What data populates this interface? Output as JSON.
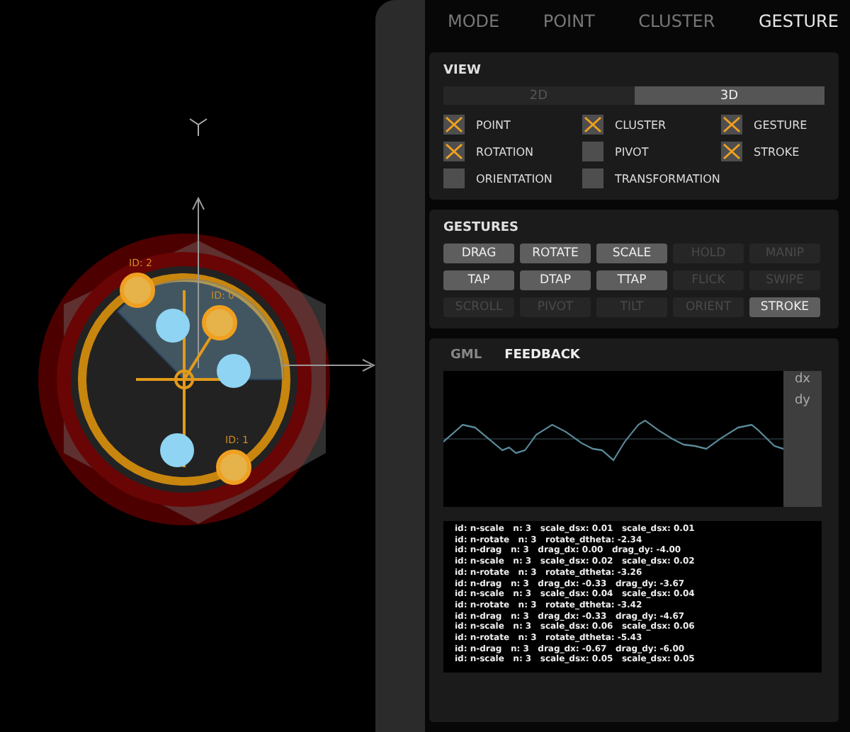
{
  "tabs": [
    {
      "label": "MODE",
      "selected": false
    },
    {
      "label": "POINT",
      "selected": false
    },
    {
      "label": "CLUSTER",
      "selected": false
    },
    {
      "label": "GESTURE",
      "selected": true
    }
  ],
  "view": {
    "title": "VIEW",
    "modes": [
      {
        "label": "2D",
        "selected": false
      },
      {
        "label": "3D",
        "selected": true
      }
    ],
    "options": [
      {
        "label": "POINT",
        "checked": true
      },
      {
        "label": "CLUSTER",
        "checked": true
      },
      {
        "label": "GESTURE",
        "checked": true
      },
      {
        "label": "ROTATION",
        "checked": true
      },
      {
        "label": "PIVOT",
        "checked": false
      },
      {
        "label": "STROKE",
        "checked": true
      },
      {
        "label": "ORIENTATION",
        "checked": false
      },
      {
        "label": "TRANSFORMATION",
        "checked": false
      }
    ]
  },
  "gestures": {
    "title": "GESTURES",
    "items": [
      {
        "label": "DRAG",
        "on": true
      },
      {
        "label": "ROTATE",
        "on": true
      },
      {
        "label": "SCALE",
        "on": true
      },
      {
        "label": "HOLD",
        "on": false
      },
      {
        "label": "MANIP",
        "on": false
      },
      {
        "label": "TAP",
        "on": true
      },
      {
        "label": "DTAP",
        "on": true
      },
      {
        "label": "TTAP",
        "on": true
      },
      {
        "label": "FLICK",
        "on": false
      },
      {
        "label": "SWIPE",
        "on": false
      },
      {
        "label": "SCROLL",
        "on": false
      },
      {
        "label": "PIVOT",
        "on": false
      },
      {
        "label": "TILT",
        "on": false
      },
      {
        "label": "ORIENT",
        "on": false
      },
      {
        "label": "STROKE",
        "on": true
      }
    ]
  },
  "feedback": {
    "tabs": [
      {
        "label": "GML",
        "selected": false
      },
      {
        "label": "FEEDBACK",
        "selected": true
      }
    ],
    "legend": [
      "dx",
      "dy"
    ],
    "log": [
      "id: n-scale   n: 3   scale_dsx: 0.01   scale_dsx: 0.01",
      "id: n-rotate   n: 3   rotate_dtheta: -2.34",
      "id: n-drag   n: 3   drag_dx: 0.00   drag_dy: -4.00",
      "id: n-scale   n: 3   scale_dsx: 0.02   scale_dsx: 0.02",
      "id: n-rotate   n: 3   rotate_dtheta: -3.26",
      "id: n-drag   n: 3   drag_dx: -0.33   drag_dy: -3.67",
      "id: n-scale   n: 3   scale_dsx: 0.04   scale_dsx: 0.04",
      "id: n-rotate   n: 3   rotate_dtheta: -3.42",
      "id: n-drag   n: 3   drag_dx: -0.33   drag_dy: -4.67",
      "id: n-scale   n: 3   scale_dsx: 0.06   scale_dsx: 0.06",
      "id: n-rotate   n: 3   rotate_dtheta: -5.43",
      "id: n-drag   n: 3   drag_dx: -0.67   drag_dy: -6.00",
      "id: n-scale   n: 3   scale_dsx: 0.05   scale_dsx: 0.05"
    ]
  },
  "canvas": {
    "touch_points": [
      {
        "label": "ID: 2"
      },
      {
        "label": "ID: 0"
      },
      {
        "label": "ID: 1"
      }
    ]
  }
}
